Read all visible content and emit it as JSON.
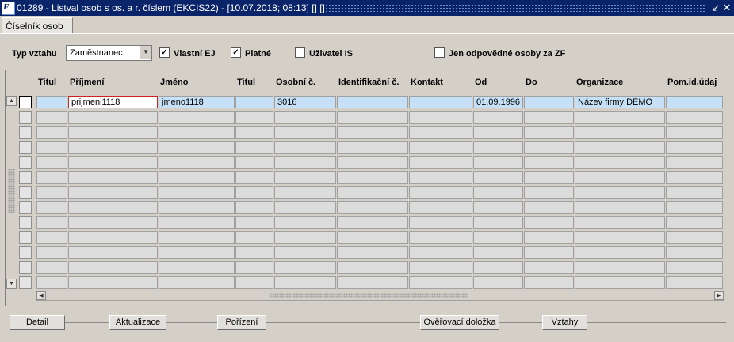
{
  "window": {
    "title": "01289 - Listval osob s os. a r. číslem (EKCIS22) - [10.07.2018; 08:13] [] []",
    "app_icon": "F"
  },
  "tab": {
    "label": "Číselník osob"
  },
  "filters": {
    "typ_vztahu_label": "Typ vztahu",
    "typ_vztahu_value": "Zaměstnanec",
    "vlastni_ej": {
      "label": "Vlastní EJ",
      "checked": true
    },
    "platne": {
      "label": "Platné",
      "checked": true
    },
    "uzivatel_is": {
      "label": "Uživatel IS",
      "checked": false
    },
    "jen_odpovedne": {
      "label": "Jen odpovědné osoby za ZF",
      "checked": false
    }
  },
  "grid": {
    "columns": [
      "Titul",
      "Příjmení",
      "Jméno",
      "Titul",
      "Osobní č.",
      "Identifikační č.",
      "Kontakt",
      "Od",
      "Do",
      "Organizace",
      "Pom.id.údaj"
    ],
    "rows": [
      [
        "",
        "prijmeni1118",
        "jmeno1118",
        "",
        "3016",
        "",
        "",
        "01.09.1996",
        "",
        "Název firmy DEMO",
        ""
      ]
    ],
    "total_visible_rows": 13
  },
  "buttons": {
    "detail": "Detail",
    "aktualizace": "Aktualizace",
    "porizeni": "Pořízení",
    "overovaci": "Ověřovací doložka",
    "vztahy": "Vztahy"
  },
  "icons": {
    "close": "close-icon",
    "minimize": "minimize-icon",
    "checkmark": "✓"
  }
}
